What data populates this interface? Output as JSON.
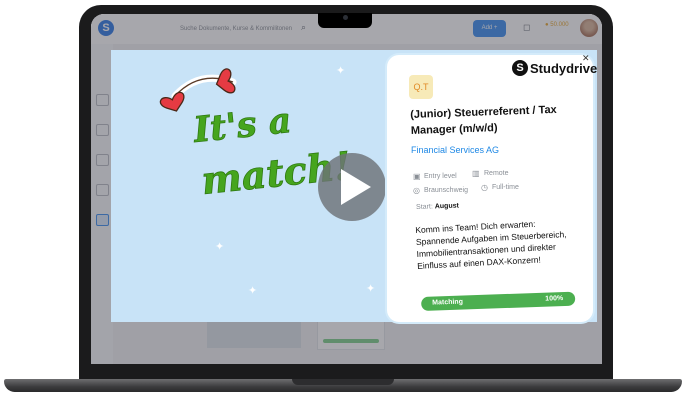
{
  "app": {
    "search_placeholder": "Suche Dokumente, Kurse & Kommilitonen",
    "add_label": "Add",
    "coins": "50.000"
  },
  "video": {
    "headline_line1": "It's a",
    "headline_line2": "match!",
    "colors": {
      "headline": "#46a51e",
      "background": "#c8e3f7",
      "heart": "#e53b43"
    }
  },
  "card": {
    "brand": "Studydrive",
    "company_initials": "Q.T",
    "job_title": "(Junior) Steuerreferent / Tax Manager (m/w/d)",
    "company": "Financial Services AG",
    "level": "Entry level",
    "location": "Braunschweig",
    "remote": "Remote",
    "employment": "Full-time",
    "start_label": "Start:",
    "start_value": "August",
    "description": "Komm ins Team! Dich erwarten: Spannende Aufgaben im Steuerbereich, Immobilientransaktionen und direkter Einfluss auf einen DAX-Konzern!",
    "matching_label": "Matching",
    "matching_value": "100%",
    "matching_fraction": 1.0
  }
}
